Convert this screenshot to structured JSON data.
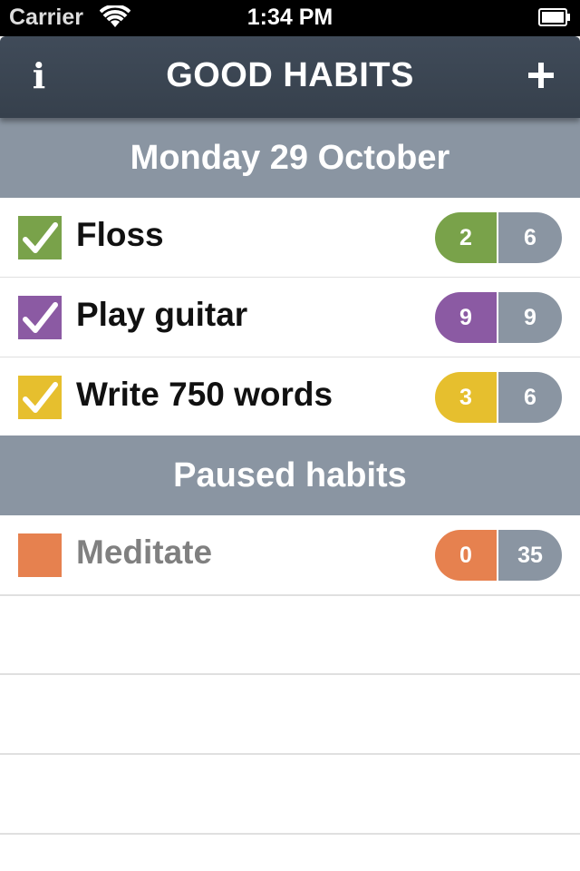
{
  "status_bar": {
    "carrier": "Carrier",
    "time": "1:34 PM",
    "icons": [
      "wifi-icon",
      "battery-icon"
    ]
  },
  "nav": {
    "title": "GOOD HABITS",
    "info_label": "i",
    "add_icon": "plus-icon"
  },
  "sections": {
    "today": "Monday 29 October",
    "paused": "Paused habits"
  },
  "habits": [
    {
      "label": "Floss",
      "checked": true,
      "color": "#79a24a",
      "count": "2",
      "total": "6"
    },
    {
      "label": "Play guitar",
      "checked": true,
      "color": "#8b5aa3",
      "count": "9",
      "total": "9"
    },
    {
      "label": "Write 750 words",
      "checked": true,
      "color": "#e6bf2e",
      "count": "3",
      "total": "6"
    }
  ],
  "paused_habits": [
    {
      "label": "Meditate",
      "checked": false,
      "color": "#e6814f",
      "count": "0",
      "total": "35"
    }
  ],
  "colors": {
    "navbar": "#3a4552",
    "section_header": "#8a95a2",
    "total_pill": "#8a95a2"
  }
}
